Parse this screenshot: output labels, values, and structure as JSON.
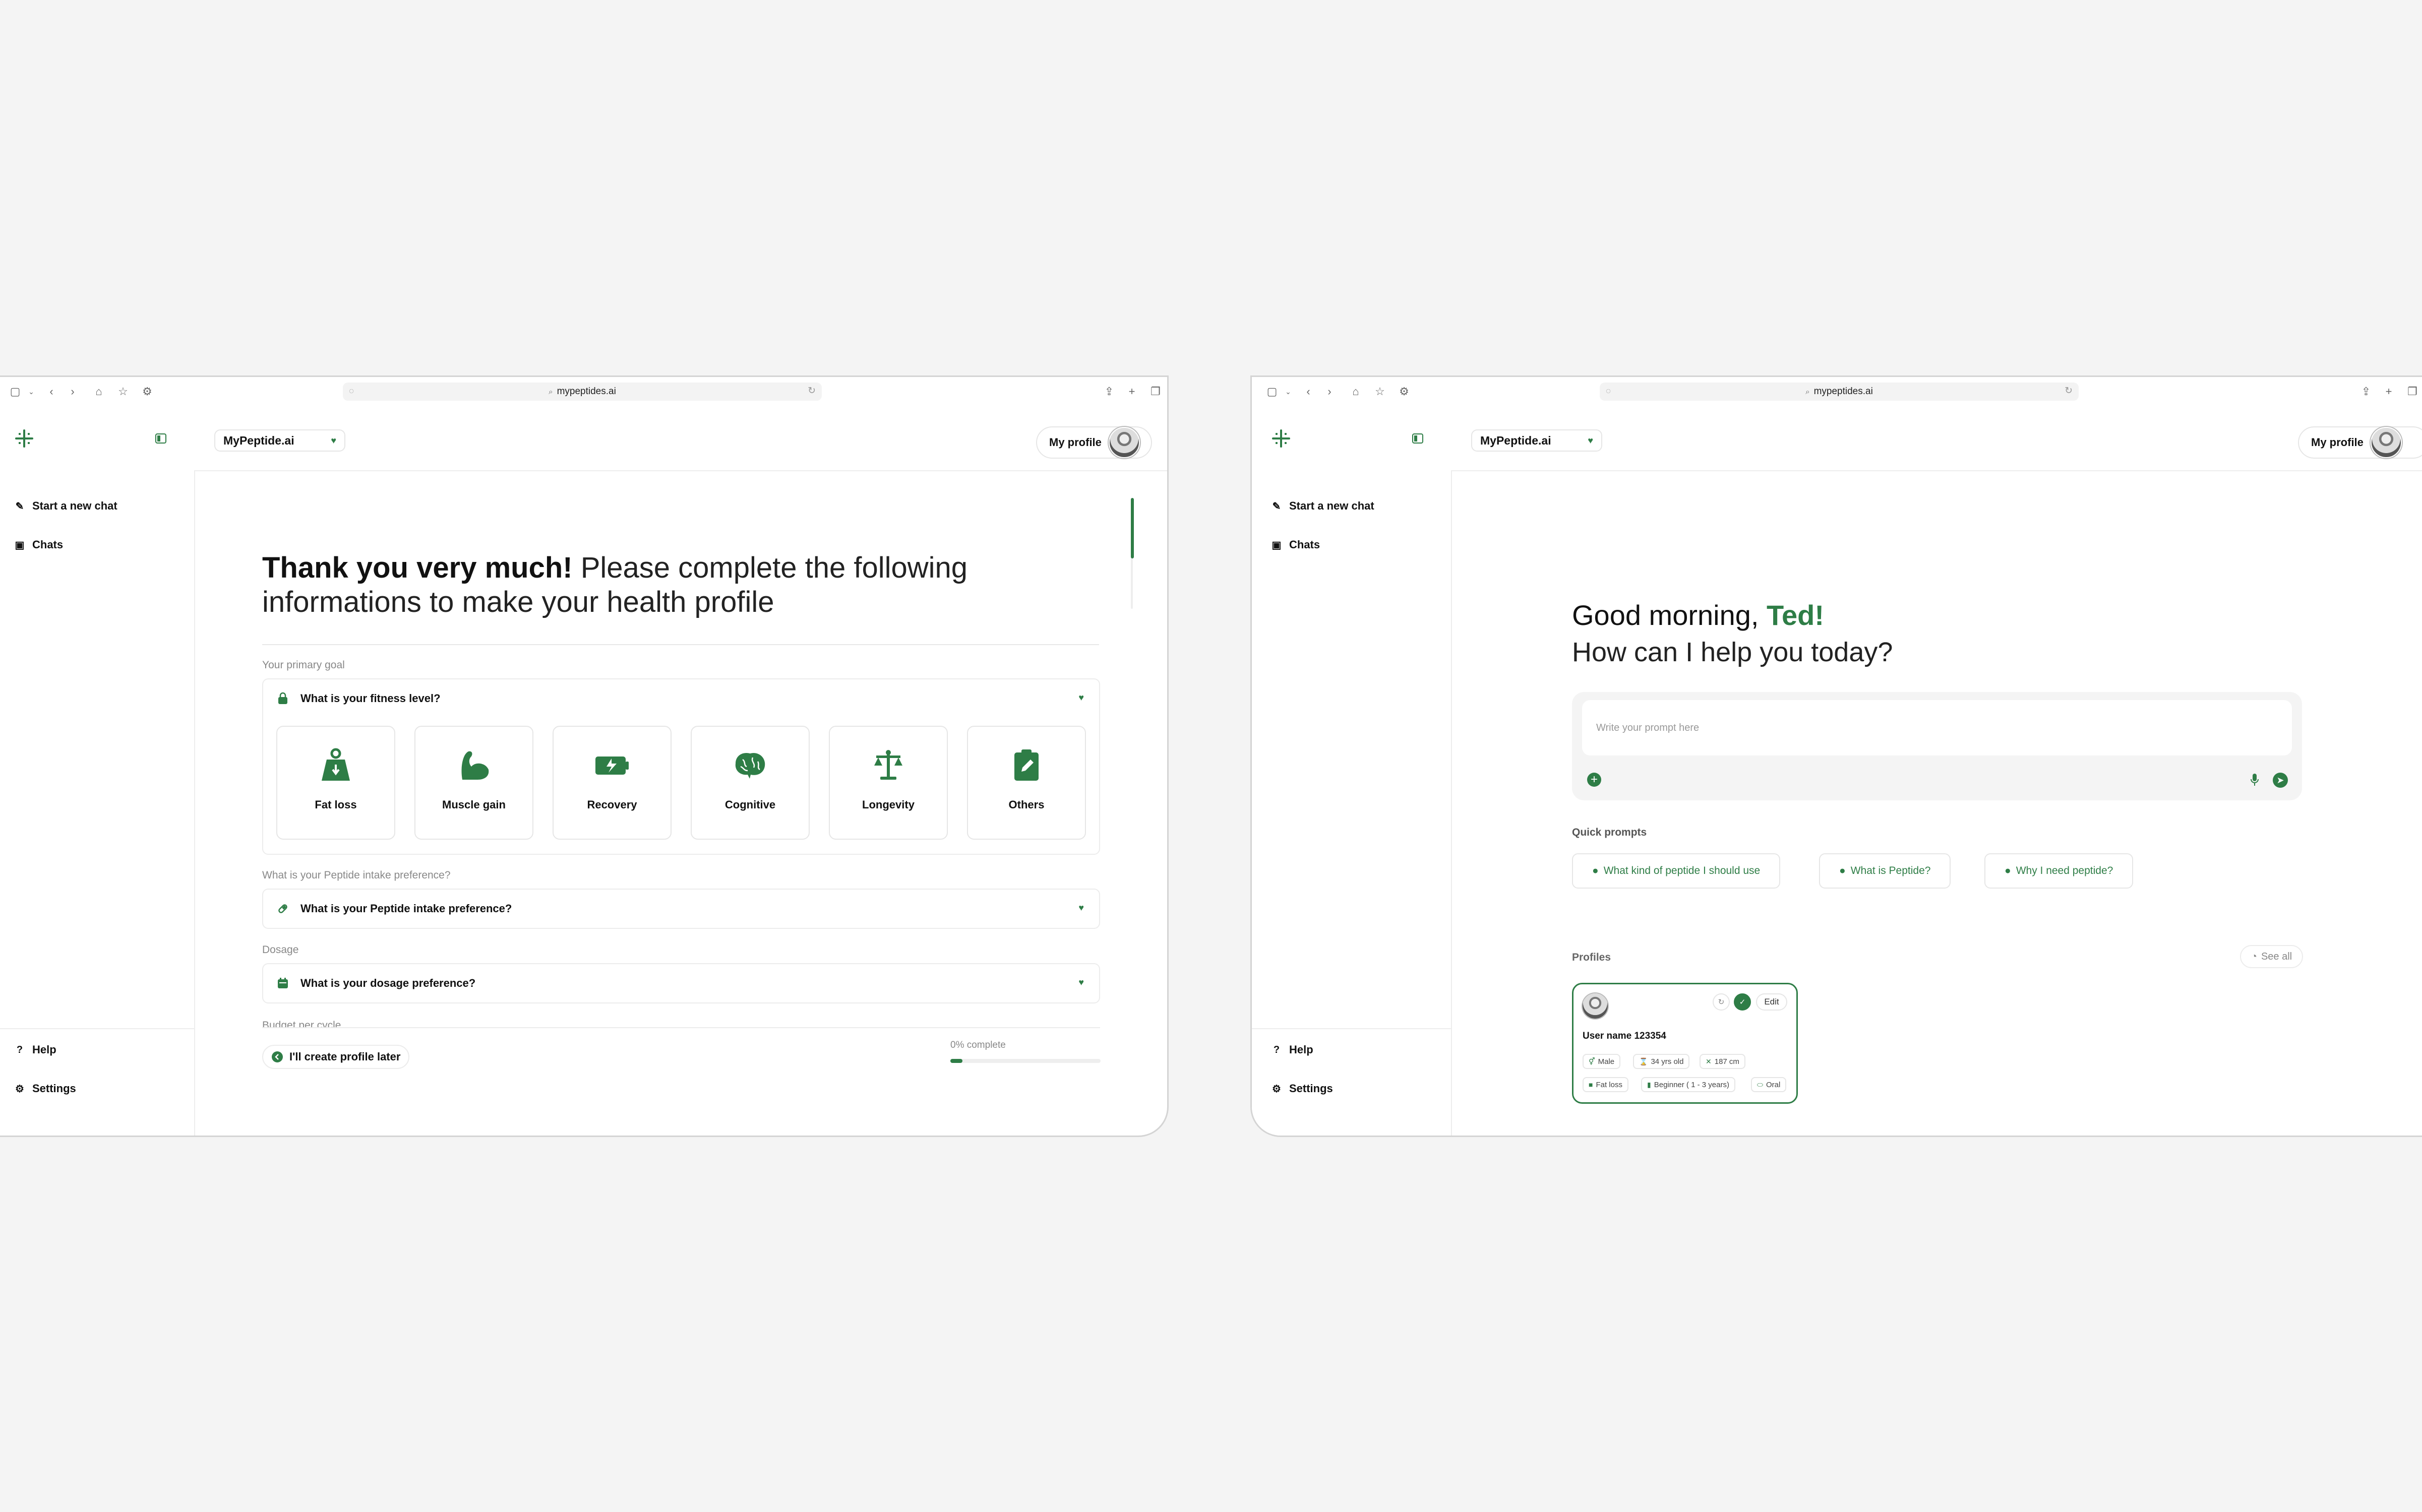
{
  "browser": {
    "url": "mypeptides.ai"
  },
  "app": {
    "name": "MyPeptide.ai",
    "profile_label": "My profile"
  },
  "sidebar": {
    "items": [
      {
        "label": "Start a new chat",
        "icon": "edit-icon"
      },
      {
        "label": "Chats",
        "icon": "chat-icon"
      }
    ],
    "bottom_items": [
      {
        "label": "Help",
        "icon": "help-icon"
      },
      {
        "label": "Settings",
        "icon": "gear-icon"
      }
    ]
  },
  "onboarding": {
    "title_bold": "Thank you very much!",
    "title_rest": " Please complete the following informations to make your health profile",
    "sections": [
      {
        "label": "Your primary goal",
        "question": "What is your fitness level?",
        "icon": "lock-bag-icon"
      },
      {
        "label": "What is your Peptide intake preference?",
        "question": "What is your Peptide intake preference?",
        "icon": "pill-icon"
      },
      {
        "label": "Dosage",
        "question": "What is your dosage preference?",
        "icon": "calendar-icon"
      },
      {
        "label": "Budget per cycle"
      }
    ],
    "goals": [
      {
        "label": "Fat loss",
        "icon": "weight-icon"
      },
      {
        "label": "Muscle gain",
        "icon": "muscle-icon"
      },
      {
        "label": "Recovery",
        "icon": "battery-icon"
      },
      {
        "label": "Cognitive",
        "icon": "brain-icon"
      },
      {
        "label": "Longevity",
        "icon": "balance-icon"
      },
      {
        "label": "Others",
        "icon": "clipboard-edit-icon"
      }
    ],
    "later_label": "I'll create profile later",
    "progress_label": "0% complete",
    "progress_value": 0.08
  },
  "home": {
    "greeting_prefix": "Good morning, ",
    "greeting_name": "Ted!",
    "subtitle": "How can I help you today?",
    "prompt_placeholder": "Write your prompt here",
    "quick_prompts_label": "Quick prompts",
    "quick_prompts": [
      "What kind of peptide I should use",
      "What is Peptide?",
      "Why I need peptide?"
    ],
    "profiles_label": "Profiles",
    "see_all_label": "See all",
    "profile_card": {
      "username": "User name 123354",
      "edit_label": "Edit",
      "tags_row1": [
        "Male",
        "34 yrs old",
        "187 cm"
      ],
      "tags_row2": [
        "Fat loss",
        "Beginner ( 1 - 3 years)",
        "Oral"
      ]
    }
  },
  "colors": {
    "accent": "#2e7d46",
    "border": "#e6e6e6",
    "background": "#f4f4f4"
  }
}
